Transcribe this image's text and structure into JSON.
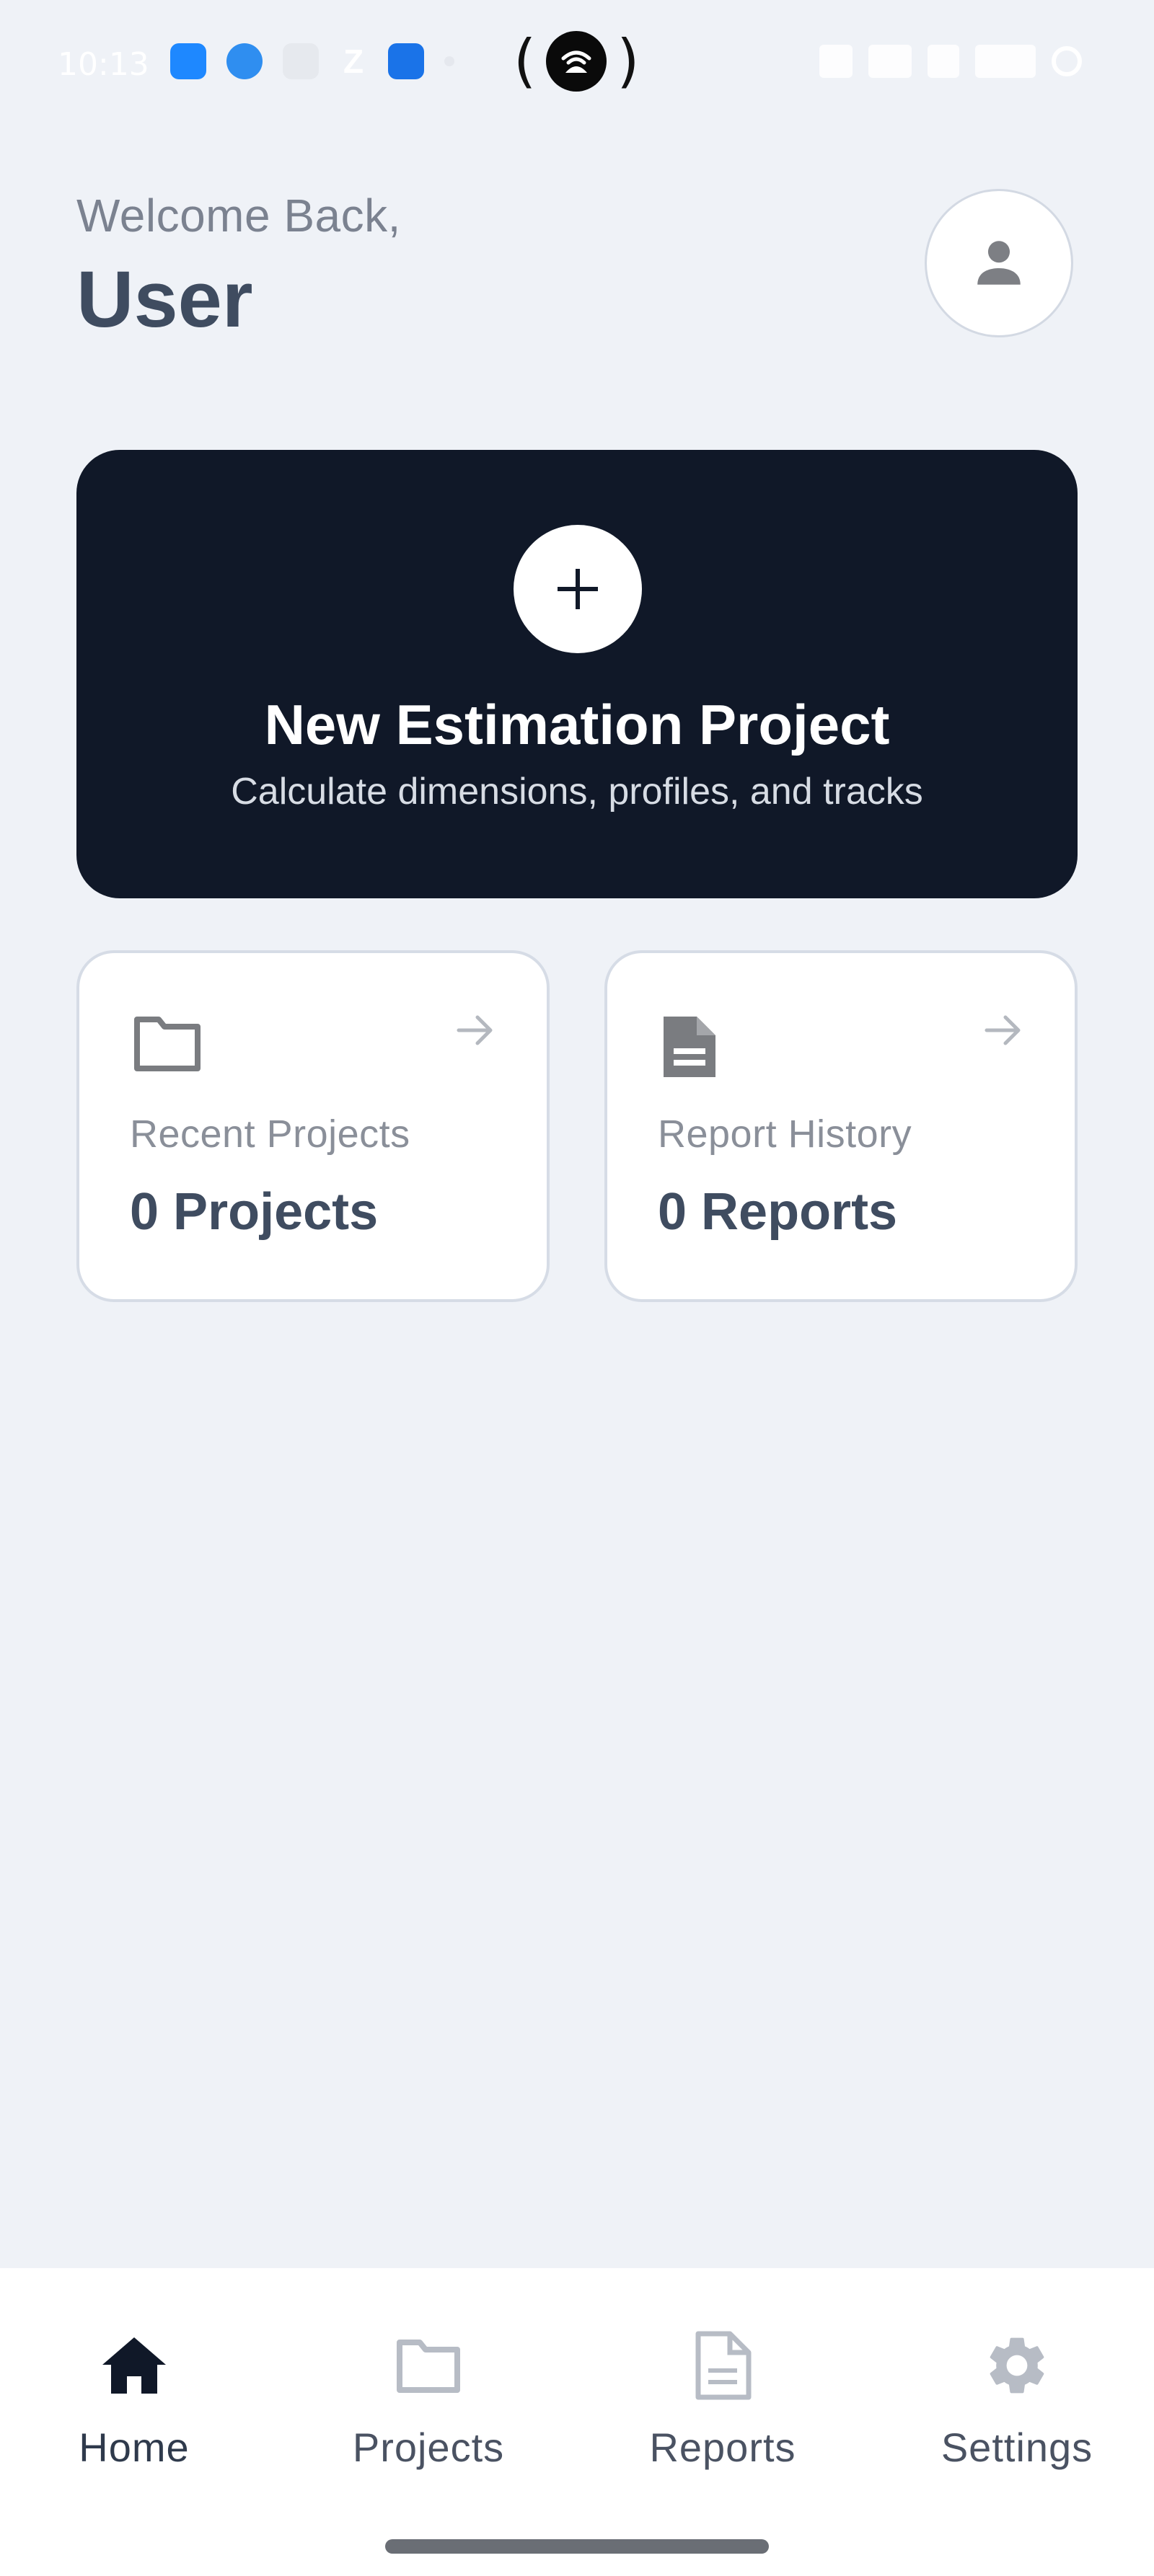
{
  "status_bar": {
    "time": "10:13",
    "icons_left": [
      "messaging-icon",
      "weather-icon",
      "clipboard-icon",
      "z-app-icon",
      "android-icon",
      "dot-icon"
    ],
    "center_icon": "hotspot-icon",
    "icons_right": [
      "alarm-icon",
      "network-speed-icon",
      "volte-icon",
      "signal-icon",
      "battery-icon"
    ]
  },
  "header": {
    "greeting": "Welcome Back,",
    "username": "User",
    "avatar_icon": "person-icon"
  },
  "hero": {
    "title": "New Estimation Project",
    "subtitle": "Calculate dimensions, profiles, and tracks",
    "icon": "plus-icon"
  },
  "cards": [
    {
      "label": "Recent Projects",
      "value": "0 Projects",
      "icon": "folder-icon"
    },
    {
      "label": "Report History",
      "value": "0 Reports",
      "icon": "document-icon"
    }
  ],
  "bottom_nav": {
    "active": "Home",
    "items": [
      {
        "label": "Home",
        "icon": "home-icon"
      },
      {
        "label": "Projects",
        "icon": "folder-icon"
      },
      {
        "label": "Reports",
        "icon": "document-icon"
      },
      {
        "label": "Settings",
        "icon": "gear-icon"
      }
    ]
  },
  "colors": {
    "background": "#eff2f7",
    "hero_bg": "#101828",
    "text_primary": "#3f4c60",
    "text_muted": "#8a8f99",
    "nav_active": "#101828",
    "nav_inactive": "#b7bcc5"
  }
}
